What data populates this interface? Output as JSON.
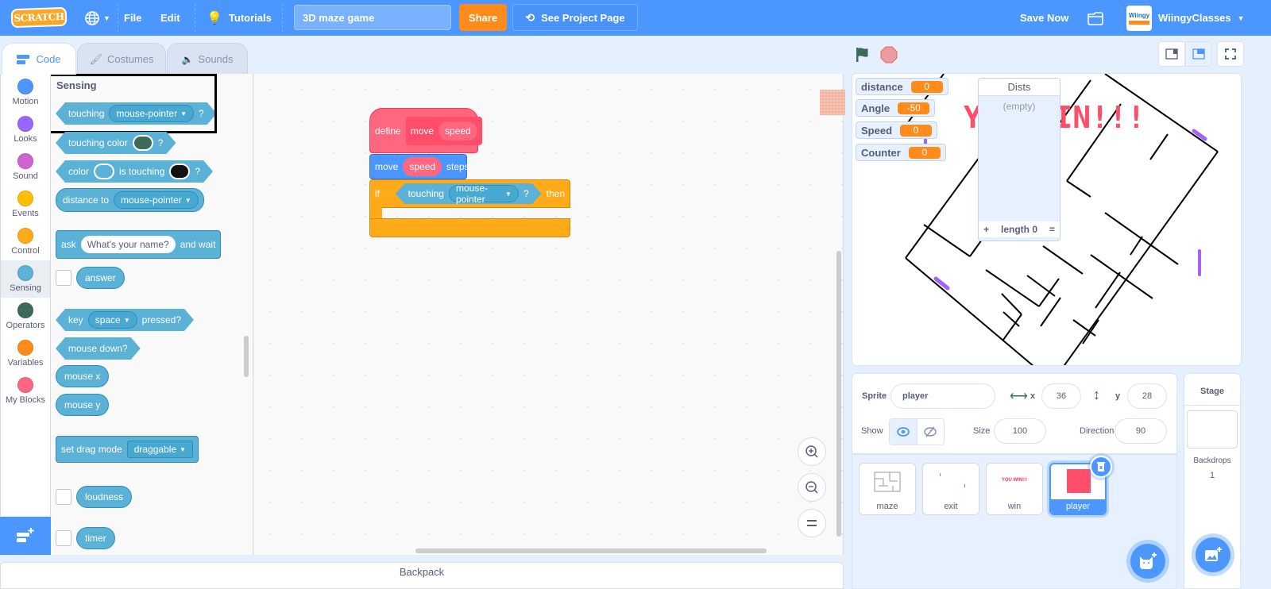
{
  "menubar": {
    "logo": "SCRATCH",
    "file": "File",
    "edit": "Edit",
    "tutorials": "Tutorials",
    "project_title": "3D maze game",
    "share": "Share",
    "see_project_page": "See Project Page",
    "save_now": "Save Now",
    "username": "WiingyClasses",
    "avatar_text": "Wiingy"
  },
  "tabs": [
    {
      "label": "Code",
      "icon": "code-icon",
      "active": true
    },
    {
      "label": "Costumes",
      "icon": "brush-icon",
      "active": false
    },
    {
      "label": "Sounds",
      "icon": "speaker-icon",
      "active": false
    }
  ],
  "categories": [
    {
      "label": "Motion",
      "color": "#4c97ff"
    },
    {
      "label": "Looks",
      "color": "#9966ff"
    },
    {
      "label": "Sound",
      "color": "#cf63cf"
    },
    {
      "label": "Events",
      "color": "#ffbf00"
    },
    {
      "label": "Control",
      "color": "#ffab19"
    },
    {
      "label": "Sensing",
      "color": "#5cb1d6",
      "selected": true
    },
    {
      "label": "Operators",
      "color": "#3d6b5a"
    },
    {
      "label": "Variables",
      "color": "#ff8c1a"
    },
    {
      "label": "My Blocks",
      "color": "#ff6680"
    }
  ],
  "palette": {
    "section": "Sensing",
    "touching": {
      "label": "touching",
      "option": "mouse-pointer",
      "q": "?"
    },
    "touching_color": {
      "label": "touching color",
      "q": "?",
      "color": "#3d6b5a"
    },
    "color_touching": {
      "a": "color",
      "b": "is touching",
      "q": "?",
      "color1": "#5cb1d6",
      "color2": "#111111"
    },
    "distance_to": {
      "label": "distance to",
      "option": "mouse-pointer"
    },
    "ask": {
      "label": "ask",
      "input": "What's your name?",
      "suffix": "and wait"
    },
    "answer": "answer",
    "key_pressed": {
      "label": "key",
      "option": "space",
      "suffix": "pressed?"
    },
    "mouse_down": "mouse down?",
    "mouse_x": "mouse x",
    "mouse_y": "mouse y",
    "drag_mode": {
      "label": "set drag mode",
      "option": "draggable"
    },
    "loudness": "loudness",
    "timer": "timer"
  },
  "script": {
    "define": {
      "label": "define",
      "name": "move",
      "param": "speed"
    },
    "move": {
      "label": "move",
      "arg": "speed",
      "suffix": "steps"
    },
    "if": {
      "label": "if",
      "cond_label": "touching",
      "cond_option": "mouse-pointer",
      "q": "?",
      "then": "then"
    }
  },
  "backpack": "Backpack",
  "stage": {
    "monitors": [
      {
        "name": "distance",
        "value": "0"
      },
      {
        "name": "Angle",
        "value": "-50"
      },
      {
        "name": "Speed",
        "value": "0"
      },
      {
        "name": "Counter",
        "value": "0"
      }
    ],
    "list": {
      "title": "Dists",
      "empty": "(empty)",
      "add": "+",
      "length": "length 0",
      "resize": "="
    },
    "win_text": "YOU WIN!!!"
  },
  "sprite_info": {
    "sprite_label": "Sprite",
    "sprite_name": "player",
    "x_label": "x",
    "x": "36",
    "y_label": "y",
    "y": "28",
    "show_label": "Show",
    "size_label": "Size",
    "size": "100",
    "direction_label": "Direction",
    "direction": "90"
  },
  "sprites": [
    {
      "name": "maze",
      "selected": false
    },
    {
      "name": "exit",
      "selected": false
    },
    {
      "name": "win",
      "selected": false,
      "thumb_text": "YOU WIN!!!"
    },
    {
      "name": "player",
      "selected": true
    }
  ],
  "stage_pane": {
    "title": "Stage",
    "backdrops_label": "Backdrops",
    "backdrops_count": "1"
  }
}
